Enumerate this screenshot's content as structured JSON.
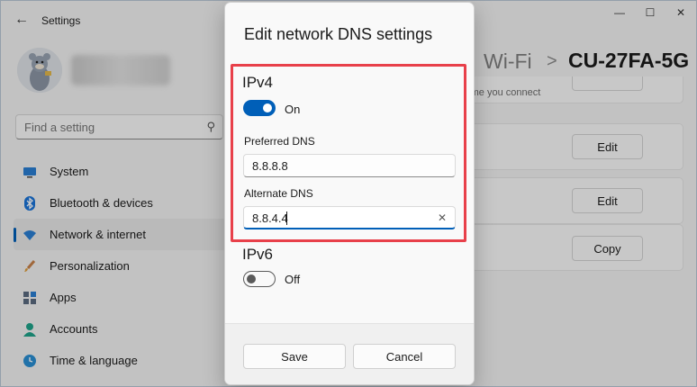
{
  "window": {
    "title": "Settings",
    "controls": {
      "minimize": "—",
      "maximize": "☐",
      "close": "✕"
    }
  },
  "sidebar": {
    "search_placeholder": "Find a setting",
    "items": [
      {
        "label": "System",
        "icon": "monitor-icon",
        "active": false
      },
      {
        "label": "Bluetooth & devices",
        "icon": "bluetooth-icon",
        "active": false
      },
      {
        "label": "Network & internet",
        "icon": "wifi-icon",
        "active": true
      },
      {
        "label": "Personalization",
        "icon": "brush-icon",
        "active": false
      },
      {
        "label": "Apps",
        "icon": "apps-icon",
        "active": false
      },
      {
        "label": "Accounts",
        "icon": "person-icon",
        "active": false
      },
      {
        "label": "Time & language",
        "icon": "globe-clock-icon",
        "active": false
      }
    ]
  },
  "breadcrumb": {
    "parent": "Wi-Fi",
    "separator": ">",
    "current": "CU-27FA-5G"
  },
  "background": {
    "partial_text": "t time you connect",
    "buttons": [
      "Edit",
      "Edit",
      "Copy"
    ]
  },
  "dialog": {
    "title": "Edit network DNS settings",
    "ipv4": {
      "title": "IPv4",
      "toggle_state": "On",
      "preferred_label": "Preferred DNS",
      "preferred_value": "8.8.8.8",
      "alternate_label": "Alternate DNS",
      "alternate_value": "8.8.4.4"
    },
    "ipv6": {
      "title": "IPv6",
      "toggle_state": "Off"
    },
    "save_label": "Save",
    "cancel_label": "Cancel"
  },
  "colors": {
    "accent": "#005fb8",
    "highlight": "#e8404a"
  }
}
